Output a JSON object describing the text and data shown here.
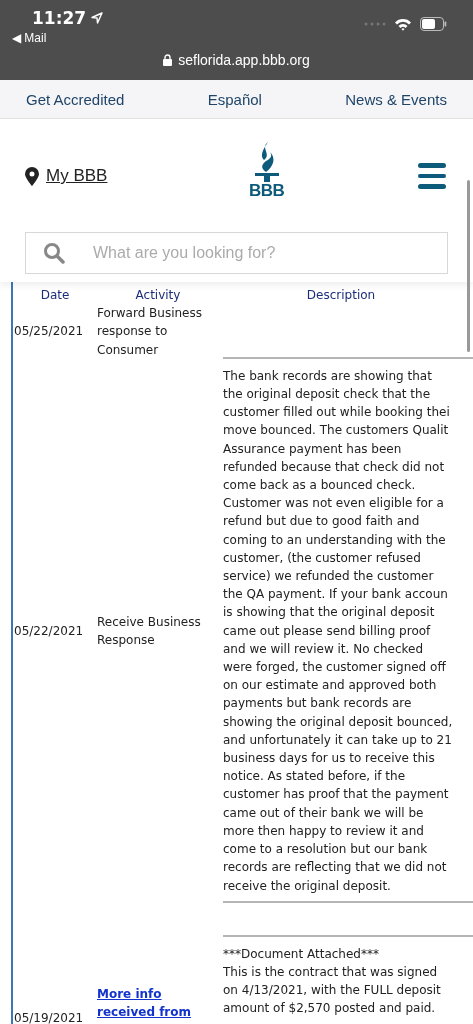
{
  "status_bar": {
    "time": "11:27",
    "back_arrow": "◀",
    "back_app": "Mail",
    "url": "seflorida.app.bbb.org"
  },
  "nav": [
    "Get Accredited",
    "Español",
    "News & Events"
  ],
  "header": {
    "my_link": "My BBB",
    "logo_text": "BBB"
  },
  "search": {
    "placeholder": "What are you looking for?"
  },
  "table": {
    "columns": [
      "Date",
      "Activity",
      "Description"
    ],
    "rows": [
      {
        "date": "05/25/2021",
        "activity": "Forward Business\nresponse to\nConsumer",
        "kind": "text"
      },
      {
        "date": "05/22/2021",
        "activity": "Receive Business\nResponse",
        "kind": "text",
        "description": "The bank records are showing that\nthe original deposit check that the\ncustomer filled out while booking thei\nmove bounced. The customers Qualit\nAssurance payment has been\nrefunded because that check did not\ncome back as a bounced check.\nCustomer was not even eligible for a\nrefund but due to good faith and\ncoming to an understanding with the\ncustomer, (the customer refused\nservice) we refunded the customer\nthe QA payment. If your bank accoun\nis showing that the original deposit\ncame out please send billing proof\nand we will review it. No checked\nwere forged, the customer signed off\non our estimate and approved both\npayments but bank records are\nshowing the original deposit bounced,\nand unfortunately it can take up to 21\nbusiness days for us to receive this\nnotice. As stated before, if the\ncustomer has proof that the payment\ncame out of their bank we will be\nmore then happy to review it and\ncome to a resolution but our bank\nrecords are reflecting that we did not\nreceive the original deposit."
      },
      {
        "date": "05/19/2021",
        "activity": "More info\nreceived from",
        "kind": "link",
        "description": "***Document Attached***\nThis is the contract that was signed\non 4/13/2021, with the FULL deposit\namount of $2,570 posted and paid."
      }
    ]
  }
}
